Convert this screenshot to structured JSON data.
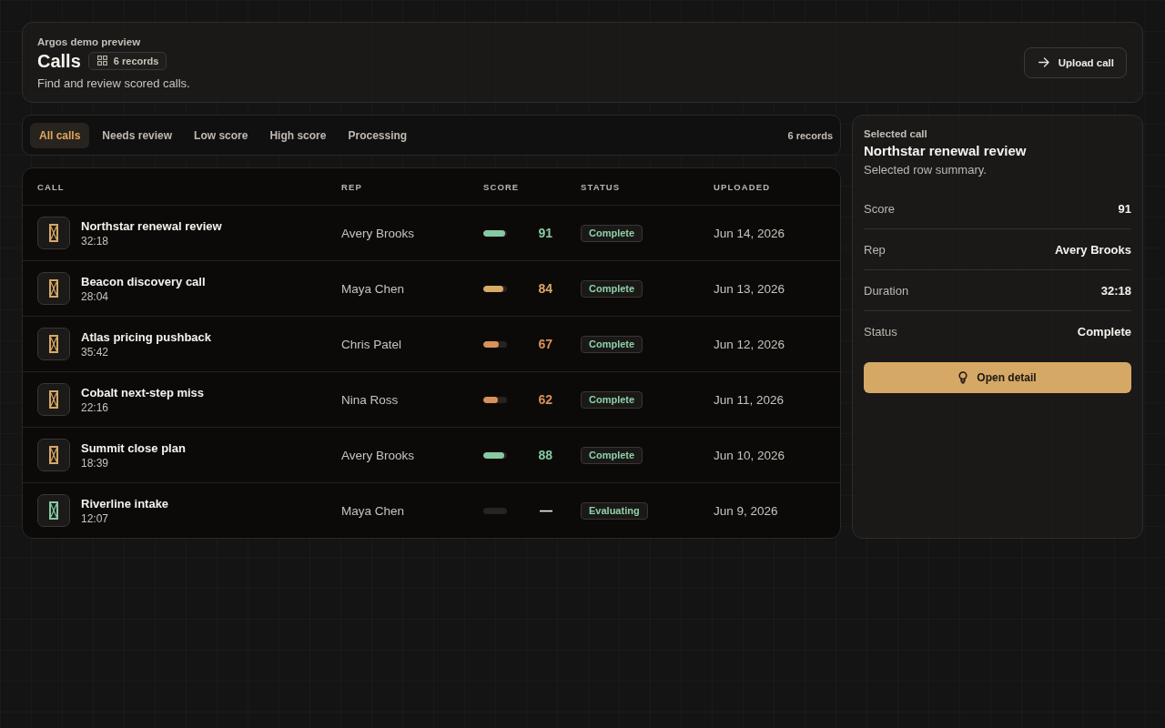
{
  "header": {
    "eyebrow": "Argos demo preview",
    "title": "Calls",
    "badge": "6 records",
    "subtitle": "Find and review scored calls.",
    "upload_button": "Upload call"
  },
  "filters": {
    "tabs": [
      {
        "label": "All calls",
        "selected": true
      },
      {
        "label": "Needs review",
        "selected": false
      },
      {
        "label": "Low score",
        "selected": false
      },
      {
        "label": "High score",
        "selected": false
      },
      {
        "label": "Processing",
        "selected": false
      }
    ],
    "count": "6 records"
  },
  "table": {
    "columns": [
      "CALL",
      "REP",
      "SCORE",
      "STATUS",
      "UPLOADED"
    ],
    "rows": [
      {
        "title": "Northstar renewal review",
        "duration": "32:18",
        "icon": {
          "color": "#d6a866"
        },
        "rep": "Avery Brooks",
        "score": {
          "text": "91",
          "level": 0.91,
          "color": "#86c9a3"
        },
        "status": "Complete",
        "uploaded": "Jun 14, 2026"
      },
      {
        "title": "Beacon discovery call",
        "duration": "28:04",
        "icon": {
          "color": "#d6a866"
        },
        "rep": "Maya Chen",
        "score": {
          "text": "84",
          "level": 0.84,
          "color": "#d9aa66"
        },
        "status": "Complete",
        "uploaded": "Jun 13, 2026"
      },
      {
        "title": "Atlas pricing pushback",
        "duration": "35:42",
        "icon": {
          "color": "#d6a866"
        },
        "rep": "Chris Patel",
        "score": {
          "text": "67",
          "level": 0.67,
          "color": "#d9905a"
        },
        "status": "Complete",
        "uploaded": "Jun 12, 2026"
      },
      {
        "title": "Cobalt next-step miss",
        "duration": "22:16",
        "icon": {
          "color": "#d6a866"
        },
        "rep": "Nina Ross",
        "score": {
          "text": "62",
          "level": 0.62,
          "color": "#d9905a"
        },
        "status": "Complete",
        "uploaded": "Jun 11, 2026"
      },
      {
        "title": "Summit close plan",
        "duration": "18:39",
        "icon": {
          "color": "#d6a866"
        },
        "rep": "Avery Brooks",
        "score": {
          "text": "88",
          "level": 0.88,
          "color": "#86c9a3"
        },
        "status": "Complete",
        "uploaded": "Jun 10, 2026"
      },
      {
        "title": "Riverline intake",
        "duration": "12:07",
        "icon": {
          "color": "#86c9a3"
        },
        "rep": "Maya Chen",
        "score": {
          "text": "—",
          "color": "#f2efea"
        },
        "status": "Evaluating",
        "uploaded": "Jun 9, 2026"
      }
    ]
  },
  "panel": {
    "label": "Selected call",
    "title": "Northstar renewal review",
    "subtitle": "Selected row summary.",
    "details": [
      {
        "label": "Score",
        "value": "91"
      },
      {
        "label": "Rep",
        "value": "Avery Brooks"
      },
      {
        "label": "Duration",
        "value": "32:18"
      },
      {
        "label": "Status",
        "value": "Complete"
      }
    ],
    "button": "Open detail"
  }
}
